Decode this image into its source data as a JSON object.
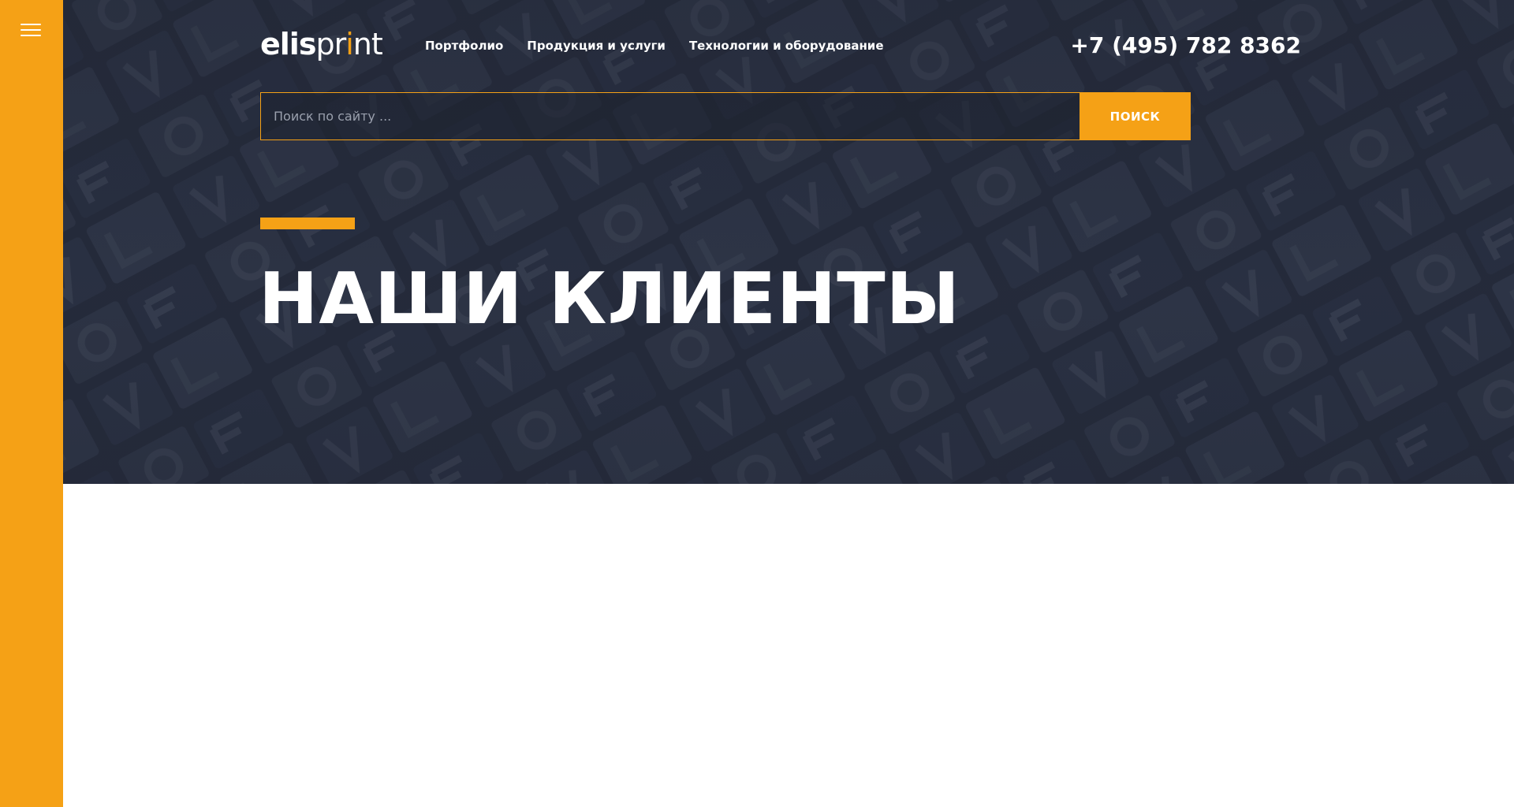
{
  "brand": {
    "logo_part1": "elis",
    "logo_part2": "pr",
    "logo_accent": "i",
    "logo_part3": "nt",
    "accent_color": "#f5a116",
    "background_color": "#242a3a"
  },
  "sidebar": {
    "menu_icon": "hamburger-menu-icon"
  },
  "nav": {
    "items": [
      {
        "label": "Портфолио"
      },
      {
        "label": "Продукция и услуги"
      },
      {
        "label": "Технологии и оборудование"
      }
    ]
  },
  "header": {
    "phone": "+7 (495) 782 8362"
  },
  "search": {
    "placeholder": "Поиск по сайту ...",
    "value": "",
    "button_label": "ПОИСК"
  },
  "hero": {
    "title": "НАШИ КЛИЕНТЫ"
  }
}
